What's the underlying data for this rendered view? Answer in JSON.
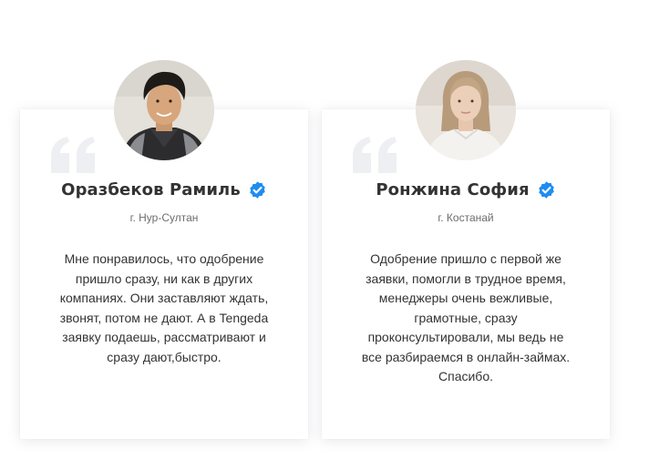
{
  "colors": {
    "accent": "#1e8df0",
    "quote": "#eeeff3",
    "text": "#333333",
    "muted": "#6d6d6d"
  },
  "testimonials": [
    {
      "name": "Оразбеков Рамиль",
      "city": "г. Нур-Султан",
      "verified_icon": "verified-check-icon",
      "quote_icon": "quote-icon",
      "review_lines": [
        "Мне понравилось, что одобрение",
        "пришло сразу, ни как в других",
        "компаниях. Они заставляют ждать,",
        "звонят, потом не дают. А в Tengeda",
        "заявку подаешь, рассматривают и",
        "сразу дают,быстро."
      ]
    },
    {
      "name": "Ронжина София",
      "city": "г. Костанай",
      "verified_icon": "verified-check-icon",
      "quote_icon": "quote-icon",
      "review_lines": [
        "Одобрение пришло с первой же",
        "заявки, помогли в трудное время,",
        "менеджеры очень вежливые,",
        "грамотные, сразу",
        "проконсультировали, мы ведь не",
        "все разбираемся в онлайн-займах.",
        "Спасибо."
      ]
    }
  ]
}
